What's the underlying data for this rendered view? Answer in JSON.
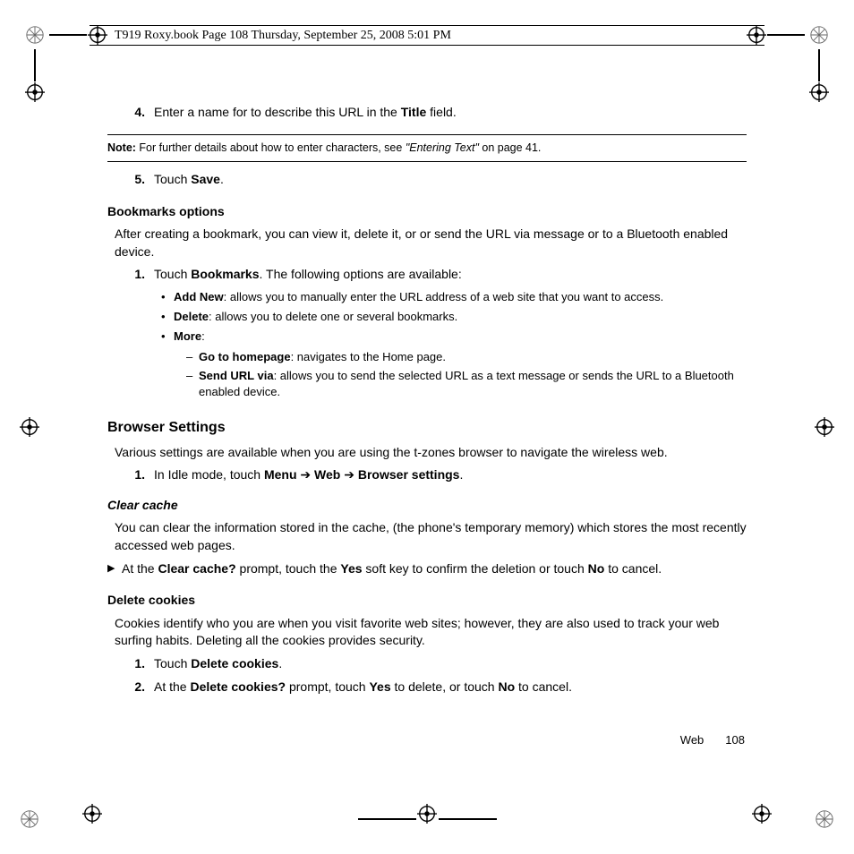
{
  "header": {
    "crop_text": "T919 Roxy.book  Page 108  Thursday, September 25, 2008  5:01 PM"
  },
  "step4": {
    "num": "4.",
    "pre": "Enter a name for to describe this URL in the ",
    "bold": "Title",
    "post": " field."
  },
  "note": {
    "label": "Note:",
    "pre": "  For further details about how to enter characters, see ",
    "italic": "\"Entering Text\"",
    "post": " on page 41."
  },
  "step5": {
    "num": "5.",
    "pre": "Touch ",
    "bold": "Save",
    "post": "."
  },
  "bookmarks_heading": "Bookmarks options",
  "bookmarks_intro": "After creating a bookmark, you can view it, delete it, or or send the URL via message or to a Bluetooth enabled device.",
  "bm_step1": {
    "num": "1.",
    "pre": "Touch ",
    "bold": "Bookmarks",
    "post": ". The following options are available:"
  },
  "bm_b1": {
    "bold": "Add New",
    "text": ": allows you to manually enter the URL address of a web site that you want to access."
  },
  "bm_b2": {
    "bold": "Delete",
    "text": ": allows you to delete one or several bookmarks."
  },
  "bm_b3": {
    "bold": "More",
    "text": ":"
  },
  "bm_s1": {
    "bold": "Go to homepage",
    "text": ": navigates to the Home page."
  },
  "bm_s2": {
    "bold": "Send URL via",
    "text": ": allows you to send the selected URL as a text message or sends the URL to a Bluetooth enabled device."
  },
  "browser_heading": "Browser Settings",
  "browser_intro": "Various settings are available when you are using the t-zones browser to navigate the wireless web.",
  "br_step1": {
    "num": "1.",
    "pre": "In Idle mode, touch ",
    "b1": "Menu",
    "a1": " ➔ ",
    "b2": "Web",
    "a2": " ➔ ",
    "b3": "Browser settings",
    "post": "."
  },
  "clear_cache_heading": "Clear cache",
  "clear_cache_text": "You can clear the information stored in the cache, (the phone's temporary memory) which stores the most recently accessed web pages.",
  "clear_cache_tri": {
    "pre": "At the ",
    "b1": "Clear cache?",
    "mid": " prompt, touch the ",
    "b2": "Yes",
    "mid2": " soft key to confirm the deletion or touch ",
    "b3": "No",
    "post": " to cancel."
  },
  "delete_cookies_heading": "Delete cookies",
  "delete_cookies_text": "Cookies identify who you are when you visit favorite web sites; however, they are also used to track your web surfing habits. Deleting all the cookies provides security.",
  "dc_step1": {
    "num": "1.",
    "pre": "Touch ",
    "bold": "Delete cookies",
    "post": "."
  },
  "dc_step2": {
    "num": "2.",
    "pre": "At the ",
    "b1": "Delete cookies?",
    "mid": " prompt, touch ",
    "b2": "Yes",
    "mid2": " to delete, or touch ",
    "b3": "No",
    "post": " to cancel."
  },
  "footer": {
    "section": "Web",
    "page": "108"
  }
}
